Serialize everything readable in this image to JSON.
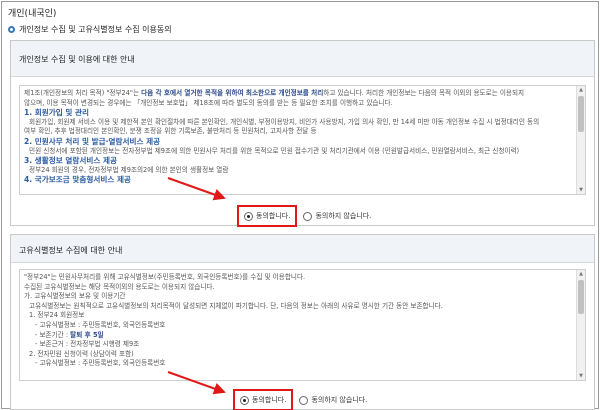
{
  "page": {
    "top_title": "개인(내국인)",
    "section_title": "개인정보 수집 및 고유식별정보 수집 이용동의"
  },
  "box1": {
    "title": "개인정보 수집 및 이용에 대한 안내",
    "lines": [
      {
        "cls": "",
        "parts": [
          {
            "t": "제1조(개인정보의 처리 목적) \"정부24\"는 ",
            "s": ""
          },
          {
            "t": "다음 각 호에서 열거한 목적을 위하여 최소한으로 개인정보를 처리",
            "s": "b"
          },
          {
            "t": "하고 있습니다. 처리한 개인정보는 다음의 목적 이외의 용도로는 이용되지",
            "s": ""
          }
        ]
      },
      {
        "cls": "",
        "parts": [
          {
            "t": "않으며, 이용 목적이 변경되는 경우에는 「개인정보 보호법」 제18조에 따라 별도의 동의를 받는 등 필요한 조치를 이행하고 있습니다.",
            "s": ""
          }
        ]
      },
      {
        "cls": "h",
        "parts": [
          {
            "t": "1. 회원가입 및 관리",
            "s": ""
          }
        ]
      },
      {
        "cls": "ind",
        "parts": [
          {
            "t": "회원가입, 회원제 서비스 이용 및 제한적 본인 확인절차에 따른 본인확인, 개인식별, 부정이용방지, 비인가 사용방지, 가입 의사 확인, 만 14세 미만 아동 개인정보 수집 시 법정대리인 동의",
            "s": ""
          }
        ]
      },
      {
        "cls": "",
        "parts": [
          {
            "t": "여부 확인, 추후 법정대리인 본인확인, 분쟁 조정을 위한 기록보존, 불만처리 등 민원처리, 고지사항 전달 등",
            "s": ""
          }
        ]
      },
      {
        "cls": "h",
        "parts": [
          {
            "t": "2. 민원사무 처리 및 발급·열람서비스 제공",
            "s": ""
          }
        ]
      },
      {
        "cls": "ind",
        "parts": [
          {
            "t": "민원 신청서에 포함된 개인정보는 전자정부법 제9조에 의한 민원사무 처리를 위한 목적으로 민원 접수기관 및 처리기관에서 이용 (민원발급서비스, 민원열람서비스, 최근 신청이력)",
            "s": ""
          }
        ]
      },
      {
        "cls": "h",
        "parts": [
          {
            "t": "3. 생활정보 열람서비스 제공",
            "s": ""
          }
        ]
      },
      {
        "cls": "ind",
        "parts": [
          {
            "t": "정부24 회원의 경우, 전자정부법 제9조의2에 의한 본인의 생활정보 열람",
            "s": ""
          }
        ]
      },
      {
        "cls": "h",
        "parts": [
          {
            "t": "4. 국가보조금 맞춤형서비스 제공",
            "s": ""
          }
        ]
      }
    ],
    "agree_label": "동의합니다.",
    "disagree_label": "동의하지 않습니다."
  },
  "box2": {
    "title": "고유식별정보 수집에 대한 안내",
    "lines": [
      {
        "cls": "",
        "parts": [
          {
            "t": "\"정부24\"는 민원사무처리를 위해 고유식별정보(주민등록번호, 외국인등록번호)를 수집 및 이용합니다.",
            "s": ""
          }
        ]
      },
      {
        "cls": "",
        "parts": [
          {
            "t": "수집된 고유식별정보는 해당 목적이외의 용도로는 이용되지 않습니다.",
            "s": ""
          }
        ]
      },
      {
        "cls": "",
        "parts": [
          {
            "t": " ",
            "s": ""
          }
        ]
      },
      {
        "cls": "",
        "parts": [
          {
            "t": "가. 고유식별정보의 보유 및 이용기간",
            "s": ""
          }
        ]
      },
      {
        "cls": "ind",
        "parts": [
          {
            "t": "고유식별정보는 원칙적으로 고유식별정보의 처리목적이 달성되면 지체없이 파기합니다. 단, 다음의 정보는 아래의 사유로 명시한 기간 동안 보존합니다.",
            "s": ""
          }
        ]
      },
      {
        "cls": "ind",
        "parts": [
          {
            "t": "1. 정부24 회원정보",
            "s": ""
          }
        ]
      },
      {
        "cls": "ind2",
        "parts": [
          {
            "t": "- 고유식별정보 : 주민등록번호, 외국인등록번호",
            "s": ""
          }
        ]
      },
      {
        "cls": "ind2",
        "parts": [
          {
            "t": "- 보존기간 : ",
            "s": ""
          },
          {
            "t": "탈퇴 후 5일",
            "s": "b"
          }
        ]
      },
      {
        "cls": "ind2",
        "parts": [
          {
            "t": "- 보존근거 : 전자정부법 시행령 제9조",
            "s": ""
          }
        ]
      },
      {
        "cls": "ind",
        "parts": [
          {
            "t": "2. 전자민원 신청이력 (상담이력 포함)",
            "s": ""
          }
        ]
      },
      {
        "cls": "ind2",
        "parts": [
          {
            "t": "- 고유식별정보 : 주민등록번호, 외국인등록번호",
            "s": ""
          }
        ]
      }
    ],
    "agree_label": "동의합니다.",
    "disagree_label": "동의하지 않습니다."
  },
  "colors": {
    "highlight": "#e01818",
    "accent": "#2a5aa0",
    "header_bg": "#f0f3f7"
  },
  "icons": {
    "section": "circle-bullet-icon",
    "arrow": "red-arrow-icon",
    "scroll_up": "scroll-up-icon",
    "scroll_down": "scroll-down-icon"
  }
}
